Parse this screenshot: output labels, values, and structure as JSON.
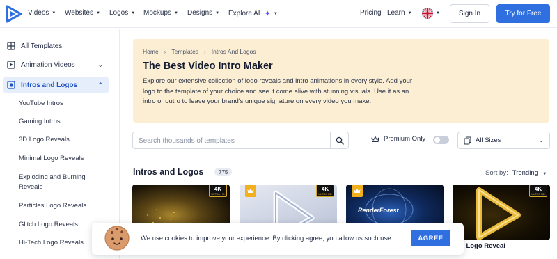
{
  "nav": {
    "items": [
      {
        "label": "Videos"
      },
      {
        "label": "Websites"
      },
      {
        "label": "Logos"
      },
      {
        "label": "Mockups"
      },
      {
        "label": "Designs"
      },
      {
        "label": "Explore AI"
      }
    ],
    "pricing": "Pricing",
    "learn": "Learn",
    "language_icon": "uk-flag-icon",
    "sign_in": "Sign In",
    "try_free": "Try for Free"
  },
  "sidebar": {
    "all_templates": "All Templates",
    "animation_videos": "Animation Videos",
    "intros_and_logos": "Intros and Logos",
    "sub_items": [
      "YouTube Intros",
      "Gaming Intros",
      "3D Logo Reveals",
      "Minimal Logo Reveals",
      "Exploding and Burning Reveals",
      "Particles Logo Reveals",
      "Glitch Logo Reveals",
      "Hi-Tech Logo Reveals"
    ]
  },
  "banner": {
    "breadcrumbs": [
      "Home",
      "Templates",
      "Intros And Logos"
    ],
    "title": "The Best Video Intro Maker",
    "description": "Explore our extensive collection of logo reveals and intro animations in every style. Add your logo to the template of your choice and see it come alive with stunning visuals. Use it as an intro or outro to leave your brand's unique signature on every video you make."
  },
  "search": {
    "placeholder": "Search thousands of templates",
    "value": ""
  },
  "filters": {
    "premium_only": "Premium Only",
    "premium_enabled": false,
    "sizes": "All Sizes"
  },
  "section": {
    "title": "Intros and Logos",
    "count": "775",
    "sort_label": "Sort by:",
    "sort_value": "Trending"
  },
  "cards": [
    {
      "badge": "4K",
      "badge_sub": "ULTRA HD",
      "premium": false
    },
    {
      "badge": "4K",
      "badge_sub": "ULTRA HD",
      "premium": true
    },
    {
      "badge": "",
      "badge_sub": "",
      "premium": true,
      "caption": "RenderForest"
    },
    {
      "badge": "4K",
      "badge_sub": "ULTRA HD",
      "premium": false,
      "title": "d Logo Reveal"
    }
  ],
  "cookie": {
    "text": "We use cookies to improve your experience. By clicking agree, you allow us such use.",
    "agree": "AGREE"
  },
  "colors": {
    "brand_blue": "#2f6fe0",
    "banner_bg": "#fbeed3",
    "active_bg": "#e6eefc",
    "premium_gold": "#f2b01e"
  }
}
